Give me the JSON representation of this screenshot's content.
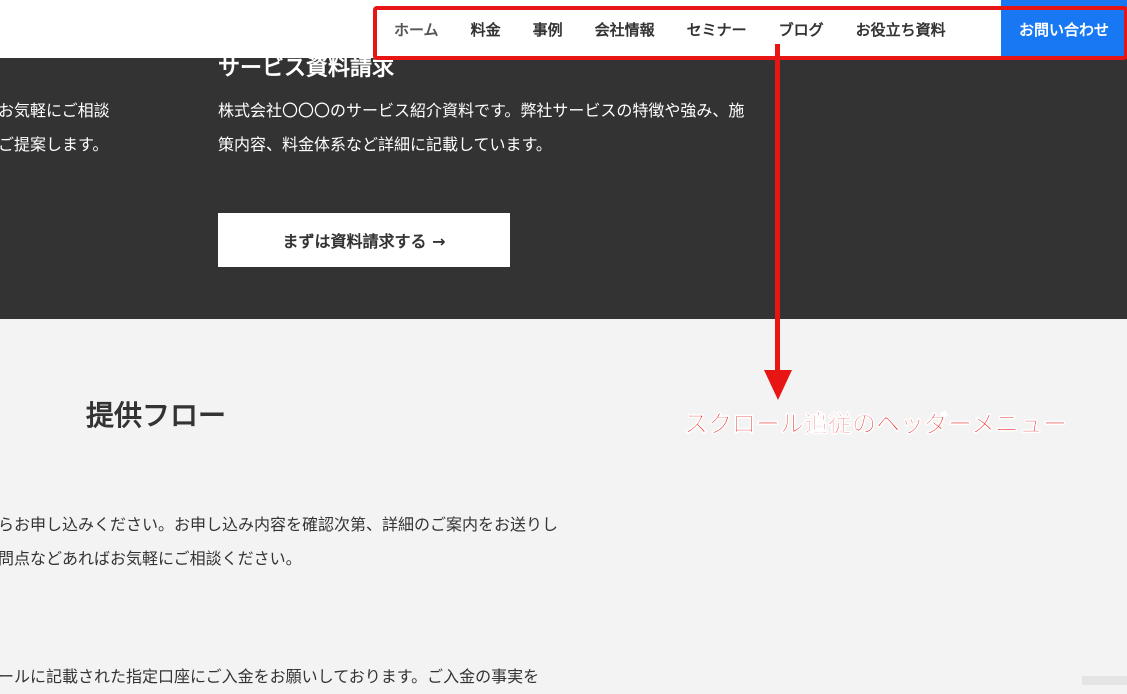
{
  "nav": {
    "items": [
      "ホーム",
      "料金",
      "事例",
      "会社情報",
      "セミナー",
      "ブログ",
      "お役立ち資料"
    ],
    "cta": "お問い合わせ"
  },
  "hero": {
    "cut_title": "サービス資料請求",
    "left_lines": [
      "お気軽にご相談",
      "ご提案します。"
    ],
    "description": "株式会社〇〇〇のサービス紹介資料です。弊社サービスの特徴や強み、施策内容、料金体系など詳細に記載しています。",
    "button_label": "まずは資料請求する →"
  },
  "flow": {
    "title": "提供フロー",
    "text_lines_1": [
      "らお申し込みください。お申し込み内容を確認次第、詳細のご案内をお送りし",
      "問点などあればお気軽にご相談ください。"
    ],
    "text_lines_2": [
      "ールに記載された指定口座にご入金をお願いしております。ご入金の事実を"
    ]
  },
  "annotation": {
    "label": "スクロール追従のヘッダーメニュー",
    "color": "#e81515"
  },
  "colors": {
    "cta_blue": "#1877f2",
    "dark_band": "#333333",
    "page_bg": "#f2f3f2"
  }
}
